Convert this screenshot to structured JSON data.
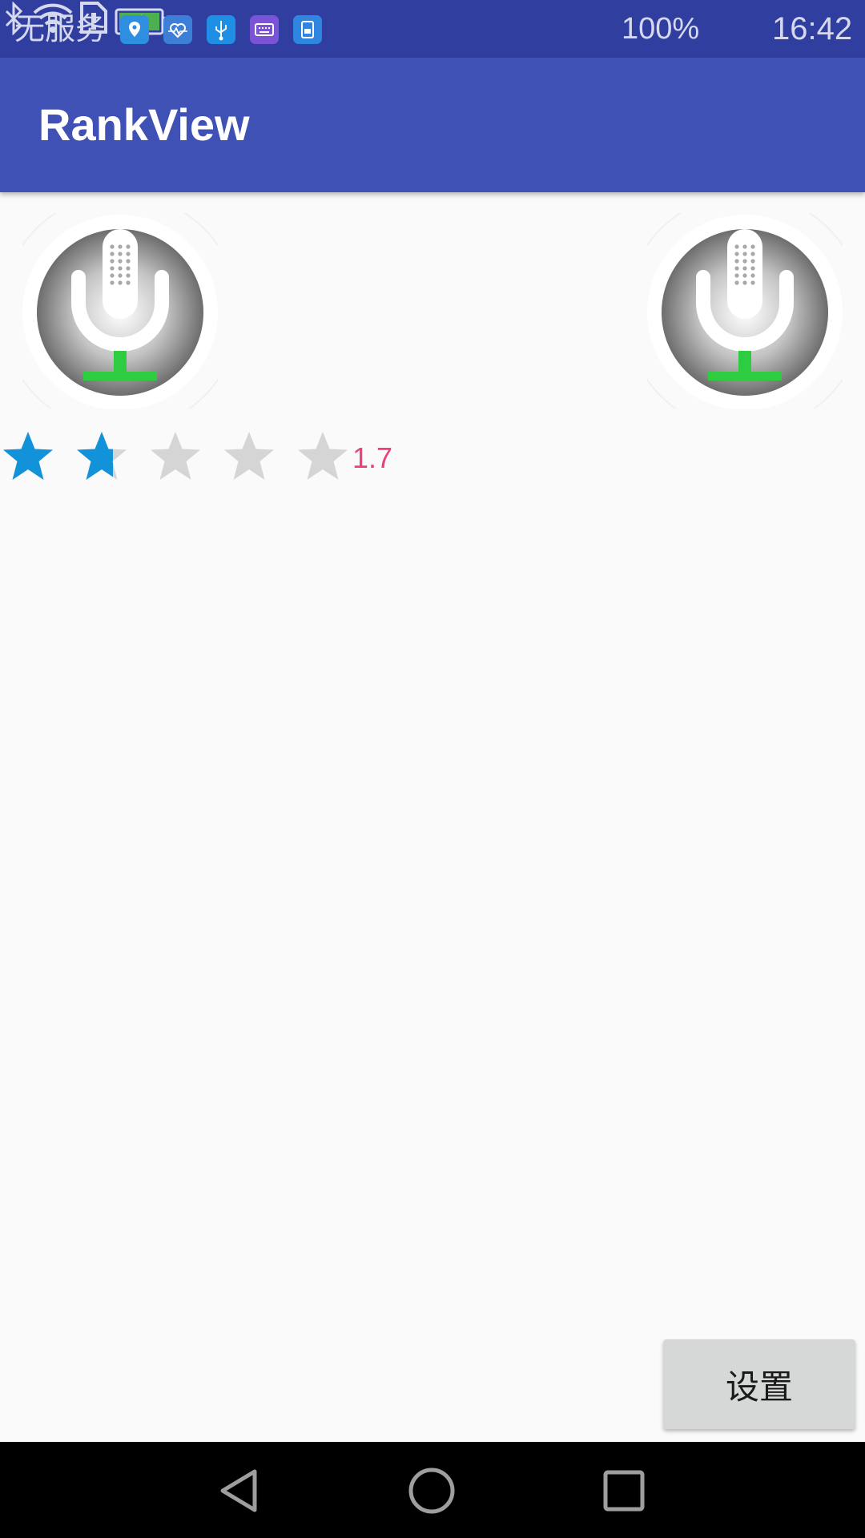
{
  "status_bar": {
    "carrier": "无服务",
    "notification_icons": [
      "location-icon",
      "health-icon",
      "usb-icon",
      "keyboard-icon",
      "sim-icon"
    ],
    "indicator_icons": [
      "bluetooth-icon",
      "wifi-icon",
      "sim-card-alert-icon"
    ],
    "battery_percent": "100%",
    "battery_icon": "battery-charging-icon",
    "time": "16:42"
  },
  "app_bar": {
    "title": "RankView"
  },
  "mic_buttons": [
    {
      "icon": "microphone-icon"
    },
    {
      "icon": "microphone-icon"
    }
  ],
  "rating": {
    "value_label": "1.7",
    "value": 1.7,
    "max": 5,
    "filled_color": "#1292d8",
    "empty_color": "#d5d5d5",
    "label_color": "#ee3f7a"
  },
  "settings_button": {
    "label": "设置"
  },
  "nav_bar": {
    "icons": [
      "back-icon",
      "home-icon",
      "recents-icon"
    ]
  },
  "colors": {
    "status_bar": "#303f9f",
    "app_bar": "#3f51b5",
    "background": "#fafafa"
  }
}
